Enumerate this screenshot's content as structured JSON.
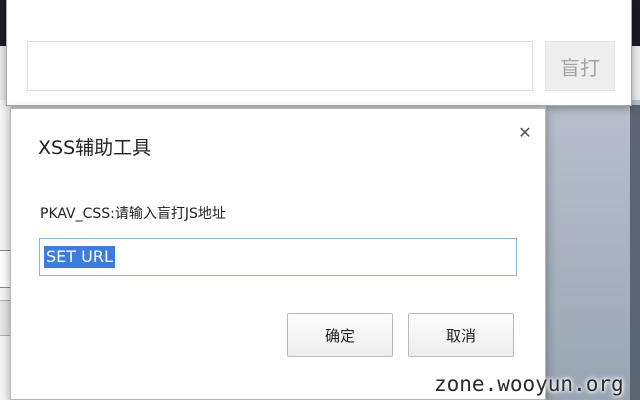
{
  "top_popup": {
    "url_input_value": "",
    "blind_button_label": "盲打"
  },
  "dialog": {
    "title": "XSS辅助工具",
    "close_glyph": "✕",
    "prompt_label": "PKAV_CSS:请输入盲打JS地址",
    "input_value": "SET URL",
    "ok_label": "确定",
    "cancel_label": "取消"
  },
  "watermark": "zone.wooyun.org",
  "colors": {
    "selection": "#3b7ddf",
    "input_focus_border": "#8fb1d3",
    "blind_button_text": "#a3a3a3"
  }
}
